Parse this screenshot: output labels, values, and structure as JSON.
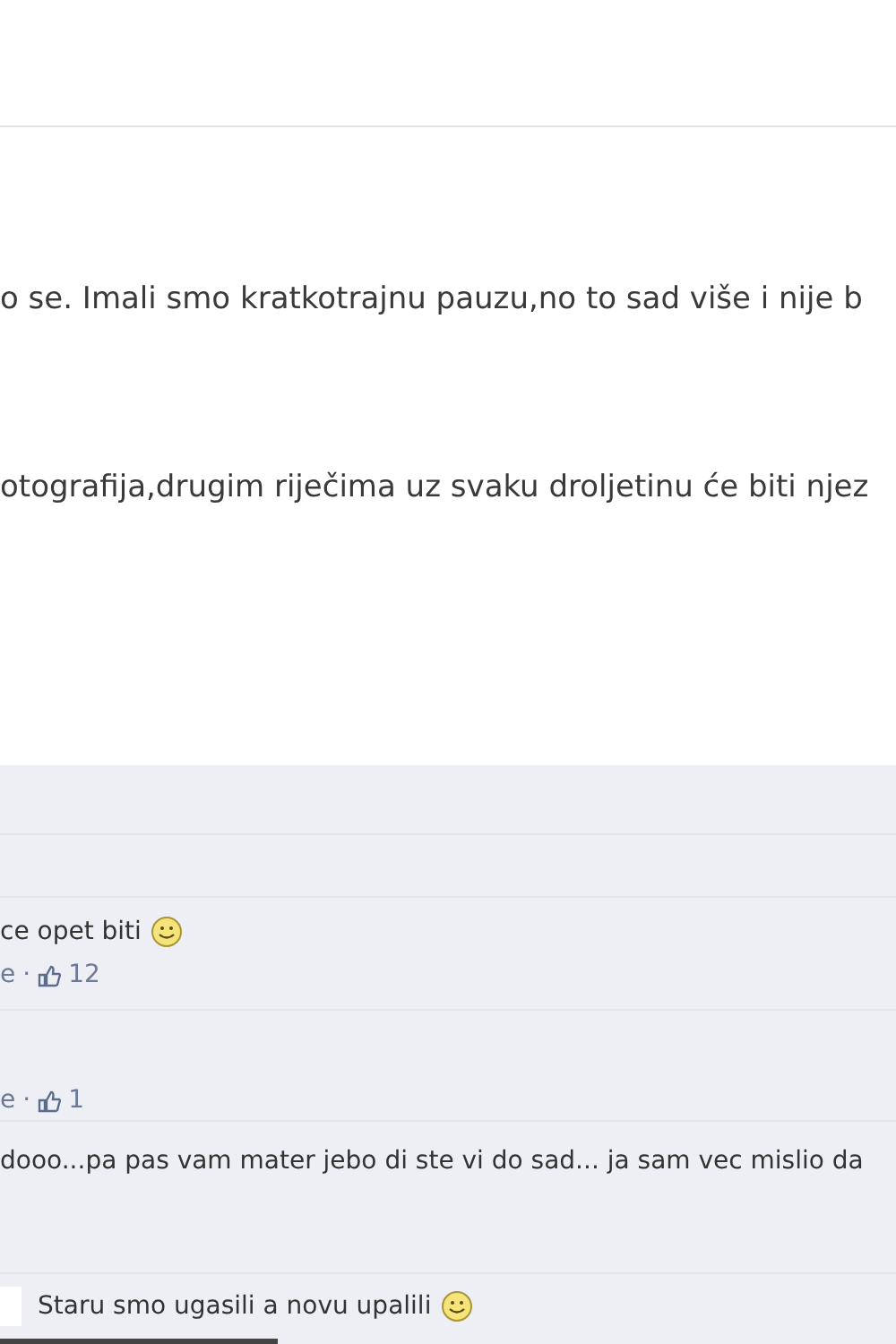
{
  "post": {
    "lines": [
      "o se. Imali smo kratkotrajnu pauzu,no to sad više i nije b",
      "otografija,drugim riječima uz svaku droljetinu će biti njez"
    ]
  },
  "comments": [
    {
      "kind": "blank"
    },
    {
      "kind": "blank"
    },
    {
      "kind": "comment",
      "text": "ce opet biti",
      "smiley": true,
      "action": "e",
      "separator": "·",
      "likes": "12"
    },
    {
      "kind": "meta",
      "action": "e",
      "separator": "·",
      "likes": "1"
    },
    {
      "kind": "comment",
      "text": "dooo...pa pas vam mater jebo di ste vi do sad... ja sam vec mislio da",
      "smiley": false
    },
    {
      "kind": "comment",
      "text": "Staru smo ugasili a novu upalili",
      "smiley": true,
      "avatar": true
    }
  ]
}
